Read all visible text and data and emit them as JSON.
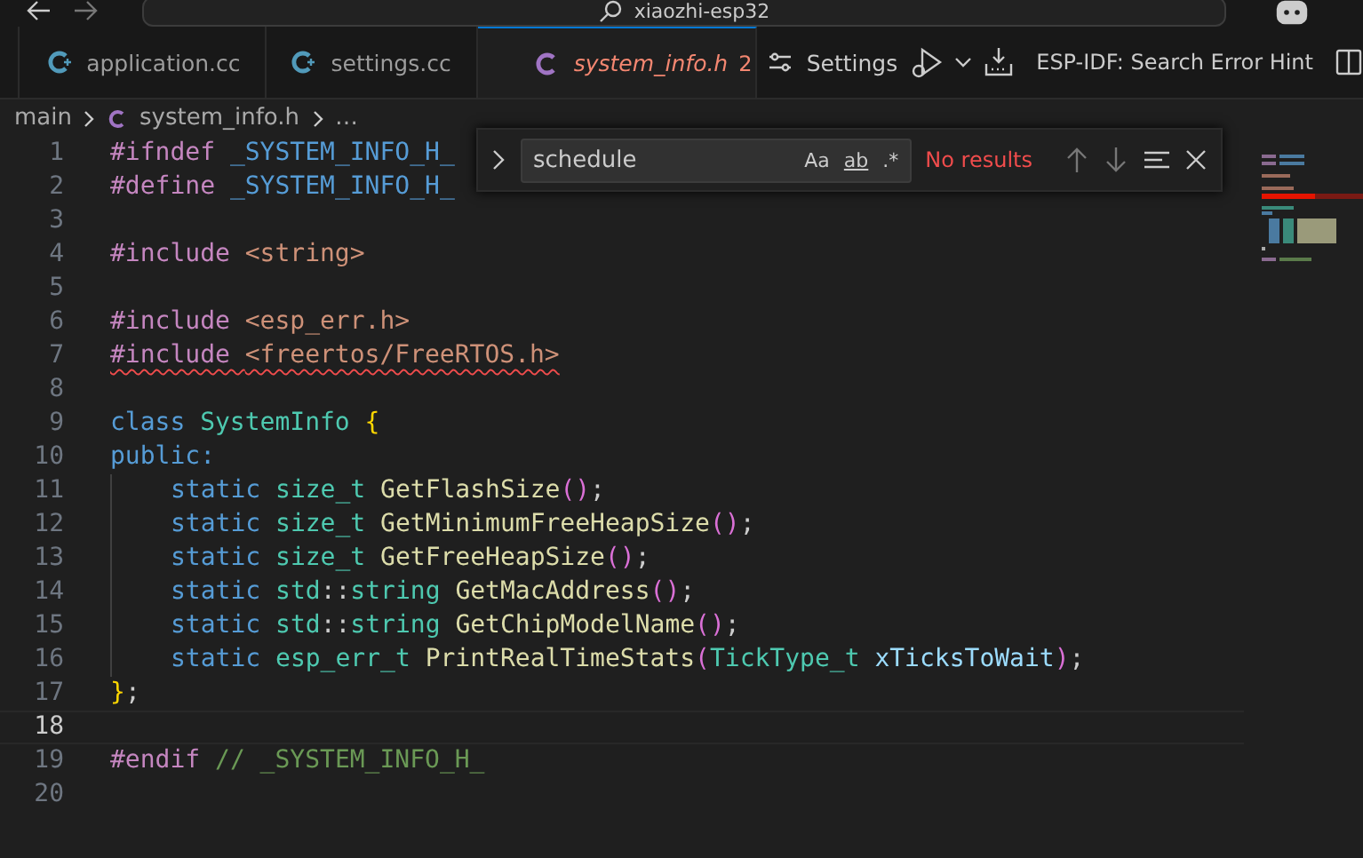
{
  "title_bar": {
    "title": "xiaozhi-esp32"
  },
  "tabs": [
    {
      "selected": false,
      "kind": "partial"
    },
    {
      "label": "application.cc",
      "selected": false,
      "kind": "cpp"
    },
    {
      "label": "settings.cc",
      "selected": false,
      "kind": "cpp"
    },
    {
      "label": "system_info.h",
      "selected": true,
      "kind": "c",
      "problems": "2"
    },
    {
      "label": "Settings",
      "selected": false,
      "kind": "settings"
    }
  ],
  "toolbar": {
    "hint_button": "ESP-IDF: Search Error Hint"
  },
  "breadcrumbs": [
    "main",
    "system_info.h",
    "…"
  ],
  "find_widget": {
    "value": "schedule",
    "options": [
      "Aa",
      "ab",
      ".*"
    ],
    "result": "No results"
  },
  "lines": [
    {
      "number": "1",
      "selected": false,
      "tokens": [
        {
          "text": "#ifndef ",
          "kind": "pre"
        },
        {
          "text": "_SYSTEM_INFO_H_",
          "kind": "macro"
        }
      ]
    },
    {
      "number": "2",
      "selected": false,
      "tokens": [
        {
          "text": "#define ",
          "kind": "pre"
        },
        {
          "text": "_SYSTEM_INFO_H_",
          "kind": "macro"
        }
      ]
    },
    {
      "number": "3",
      "selected": false
    },
    {
      "number": "4",
      "selected": false,
      "tokens": [
        {
          "text": "#include ",
          "kind": "pre"
        },
        {
          "text": "<string>",
          "kind": "str"
        }
      ]
    },
    {
      "number": "5",
      "selected": false
    },
    {
      "number": "6",
      "selected": false,
      "tokens": [
        {
          "text": "#include ",
          "kind": "pre"
        },
        {
          "text": "<esp_err.h>",
          "kind": "str"
        }
      ]
    },
    {
      "number": "7",
      "selected": false,
      "error": true,
      "tokens": [
        {
          "text": "#include ",
          "kind": "pre"
        },
        {
          "text": "<freertos/FreeRTOS.h>",
          "kind": "str"
        }
      ]
    },
    {
      "number": "8",
      "selected": false
    },
    {
      "number": "9",
      "selected": false,
      "tokens": [
        {
          "text": "class ",
          "kind": "kw"
        },
        {
          "text": "SystemInfo ",
          "kind": "type"
        },
        {
          "text": "{",
          "kind": "brace"
        }
      ]
    },
    {
      "number": "10",
      "selected": false,
      "tokens": [
        {
          "text": "public:",
          "kind": "kw"
        }
      ]
    },
    {
      "number": "11",
      "selected": false,
      "indented": true,
      "tokens": [
        {
          "text": "static ",
          "kind": "kw"
        },
        {
          "text": "size_t ",
          "kind": "type"
        },
        {
          "text": "GetFlashSize",
          "kind": "fn"
        },
        {
          "text": "()",
          "kind": "paren"
        },
        {
          "text": ";",
          "kind": "plain"
        }
      ]
    },
    {
      "number": "12",
      "selected": false,
      "indented": true,
      "tokens": [
        {
          "text": "static ",
          "kind": "kw"
        },
        {
          "text": "size_t ",
          "kind": "type"
        },
        {
          "text": "GetMinimumFreeHeapSize",
          "kind": "fn"
        },
        {
          "text": "()",
          "kind": "paren"
        },
        {
          "text": ";",
          "kind": "plain"
        }
      ]
    },
    {
      "number": "13",
      "selected": false,
      "indented": true,
      "tokens": [
        {
          "text": "static ",
          "kind": "kw"
        },
        {
          "text": "size_t ",
          "kind": "type"
        },
        {
          "text": "GetFreeHeapSize",
          "kind": "fn"
        },
        {
          "text": "()",
          "kind": "paren"
        },
        {
          "text": ";",
          "kind": "plain"
        }
      ]
    },
    {
      "number": "14",
      "selected": false,
      "indented": true,
      "tokens": [
        {
          "text": "static ",
          "kind": "kw"
        },
        {
          "text": "std",
          "kind": "type"
        },
        {
          "text": "::",
          "kind": "plain"
        },
        {
          "text": "string ",
          "kind": "type"
        },
        {
          "text": "GetMacAddress",
          "kind": "fn"
        },
        {
          "text": "()",
          "kind": "paren"
        },
        {
          "text": ";",
          "kind": "plain"
        }
      ]
    },
    {
      "number": "15",
      "selected": false,
      "indented": true,
      "tokens": [
        {
          "text": "static ",
          "kind": "kw"
        },
        {
          "text": "std",
          "kind": "type"
        },
        {
          "text": "::",
          "kind": "plain"
        },
        {
          "text": "string ",
          "kind": "type"
        },
        {
          "text": "GetChipModelName",
          "kind": "fn"
        },
        {
          "text": "()",
          "kind": "paren"
        },
        {
          "text": ";",
          "kind": "plain"
        }
      ]
    },
    {
      "number": "16",
      "selected": false,
      "indented": true,
      "tokens": [
        {
          "text": "static ",
          "kind": "kw"
        },
        {
          "text": "esp_err_t ",
          "kind": "type"
        },
        {
          "text": "PrintRealTimeStats",
          "kind": "fn"
        },
        {
          "text": "(",
          "kind": "paren"
        },
        {
          "text": "TickType_t ",
          "kind": "type"
        },
        {
          "text": "xTicksToWait",
          "kind": "var"
        },
        {
          "text": ")",
          "kind": "paren"
        },
        {
          "text": ";",
          "kind": "plain"
        }
      ]
    },
    {
      "number": "17",
      "selected": false,
      "tokens": [
        {
          "text": "}",
          "kind": "brace"
        },
        {
          "text": ";",
          "kind": "plain"
        }
      ]
    },
    {
      "number": "18",
      "selected": true
    },
    {
      "number": "19",
      "selected": false,
      "tokens": [
        {
          "text": "#endif ",
          "kind": "pre"
        },
        {
          "text": "// _SYSTEM_INFO_H_",
          "kind": "comment"
        }
      ]
    },
    {
      "number": "20",
      "selected": false
    }
  ]
}
